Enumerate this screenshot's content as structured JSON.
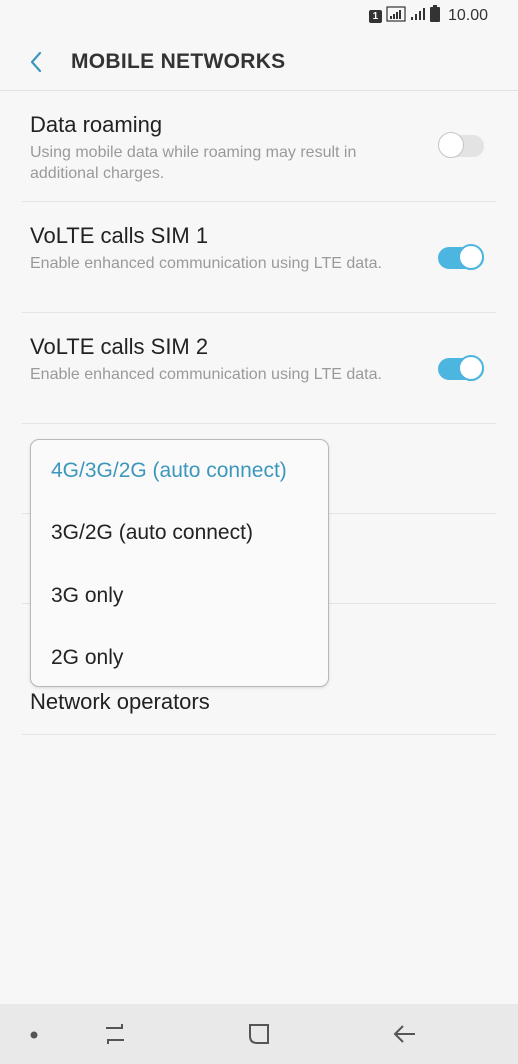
{
  "status_bar": {
    "sim_badge": "1",
    "time": "10.00",
    "icons": [
      "sim-signal-icon",
      "signal-icon",
      "battery-icon"
    ]
  },
  "header": {
    "back_icon": "chevron-left-icon",
    "title": "MOBILE NETWORKS"
  },
  "settings": [
    {
      "title": "Data roaming",
      "description": "Using mobile data while roaming may result in additional charges.",
      "toggle": "off"
    },
    {
      "title": "VoLTE calls SIM 1",
      "description": "Enable enhanced communication using LTE data.",
      "toggle": "on"
    },
    {
      "title": "VoLTE calls SIM 2",
      "description": "Enable enhanced communication using LTE data.",
      "toggle": "on"
    }
  ],
  "network_mode_dropdown": {
    "options": [
      "4G/3G/2G (auto connect)",
      "3G/2G (auto connect)",
      "3G only",
      "2G only"
    ],
    "selected": "4G/3G/2G (auto connect)"
  },
  "network_operators_label": "Network operators",
  "nav_bar": {
    "icons": [
      "dot-icon",
      "recent-apps-icon",
      "home-icon",
      "back-arrow-icon"
    ]
  },
  "colors": {
    "accent": "#4cb5e0",
    "selected_text": "#3d97bc",
    "background": "#f7f7f7"
  }
}
